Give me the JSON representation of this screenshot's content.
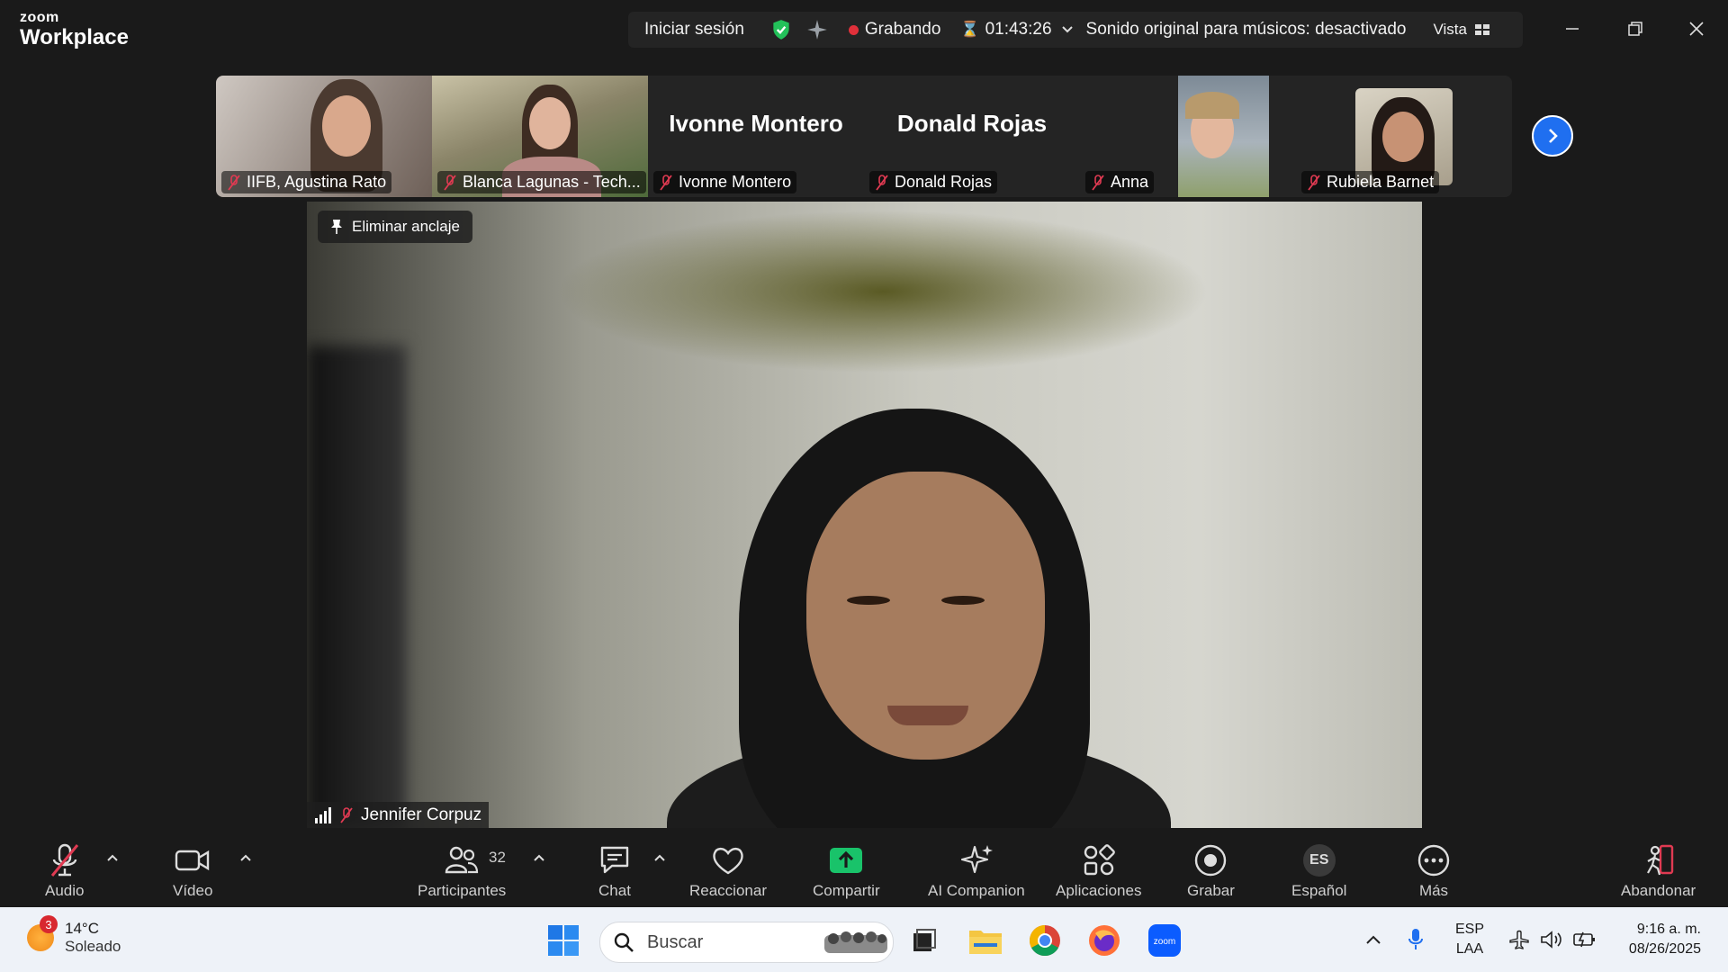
{
  "titlebar": {
    "logo_small": "zoom",
    "logo_big": "Workplace",
    "signin": "Iniciar sesión",
    "recording": "Grabando",
    "timer": "01:43:26",
    "sound": "Sonido original para músicos: desactivado",
    "view": "Vista"
  },
  "participants_strip": [
    {
      "name": "IIFB, Agustina Rato",
      "type": "video"
    },
    {
      "name": "Blanca Lagunas - Tech...",
      "type": "video"
    },
    {
      "name": "Ivonne Montero",
      "type": "name-only",
      "display": "Ivonne Montero"
    },
    {
      "name": "Donald Rojas",
      "type": "name-only",
      "display": "Donald Rojas"
    },
    {
      "name": "Anna",
      "type": "video"
    },
    {
      "name": "Rubiela Barnet",
      "type": "avatar"
    }
  ],
  "main": {
    "unpin_label": "Eliminar anclaje",
    "speaker": "Jennifer Corpuz"
  },
  "toolbar": {
    "audio": "Audio",
    "video": "Vídeo",
    "participants": "Participantes",
    "participants_count": "32",
    "chat": "Chat",
    "react": "Reaccionar",
    "share": "Compartir",
    "ai": "AI Companion",
    "apps": "Aplicaciones",
    "record": "Grabar",
    "language_badge": "ES",
    "language": "Español",
    "more": "Más",
    "leave": "Abandonar"
  },
  "taskbar": {
    "weather_badge": "3",
    "temperature": "14°C",
    "condition": "Soleado",
    "search_placeholder": "Buscar",
    "lang_top": "ESP",
    "lang_bottom": "LAA",
    "time": "9:16 a. m.",
    "date": "08/26/2025"
  },
  "colors": {
    "accent_blue": "#1f6ff0",
    "record_red": "#e0303a",
    "shield_green": "#23c15a",
    "share_green": "#19c36a",
    "leave_red": "#e03a52"
  }
}
